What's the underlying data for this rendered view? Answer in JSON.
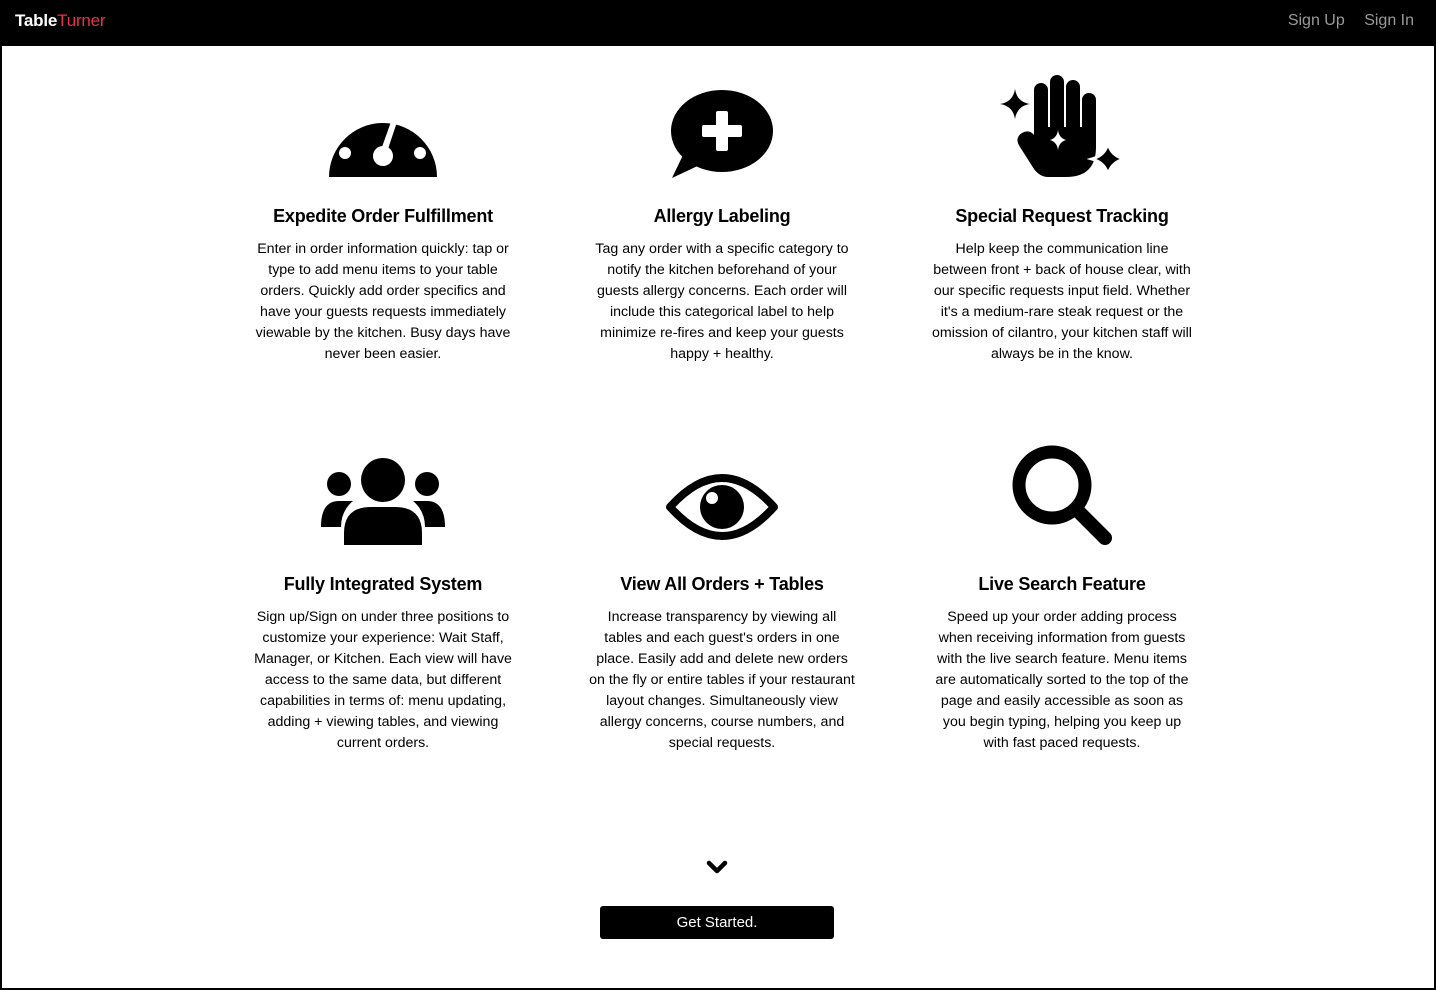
{
  "navbar": {
    "brand_part1": "Table",
    "brand_part2": "Turner",
    "brand_accent_color": "#e8344a",
    "links": [
      "Sign Up",
      "Sign In"
    ]
  },
  "features": [
    {
      "icon": "speedometer-icon",
      "title": "Expedite Order Fulfillment",
      "text": "Enter in order information quickly: tap or type to add menu items to your table orders. Quickly add order specifics and have your guests requests immediately viewable by the kitchen. Busy days have never been easier."
    },
    {
      "icon": "chat-plus-icon",
      "title": "Allergy Labeling",
      "text": "Tag any order with a specific category to notify the kitchen beforehand of your guests allergy concerns. Each order will include this categorical label to help minimize re-fires and keep your guests happy + healthy."
    },
    {
      "icon": "hand-sparkles-icon",
      "title": "Special Request Tracking",
      "text": "Help keep the communication line between front + back of house clear, with our specific requests input field. Whether it's a medium-rare steak request or the omission of cilantro, your kitchen staff will always be in the know."
    },
    {
      "icon": "users-icon",
      "title": "Fully Integrated System",
      "text": "Sign up/Sign on under three positions to customize your experience: Wait Staff, Manager, or Kitchen. Each view will have access to the same data, but different capabilities in terms of: menu updating, adding + viewing tables, and viewing current orders."
    },
    {
      "icon": "eye-icon",
      "title": "View All Orders + Tables",
      "text": "Increase transparency by viewing all tables and each guest's orders in one place. Easily add and delete new orders on the fly or entire tables if your restaurant layout changes. Simultaneously view allergy concerns, course numbers, and special requests."
    },
    {
      "icon": "search-icon",
      "title": "Live Search Feature",
      "text": "Speed up your order adding process when receiving information from guests with the live search feature. Menu items are automatically sorted to the top of the page and easily accessible as soon as you begin typing, helping you keep up with fast paced requests."
    }
  ],
  "cta": {
    "label": "Get Started."
  }
}
